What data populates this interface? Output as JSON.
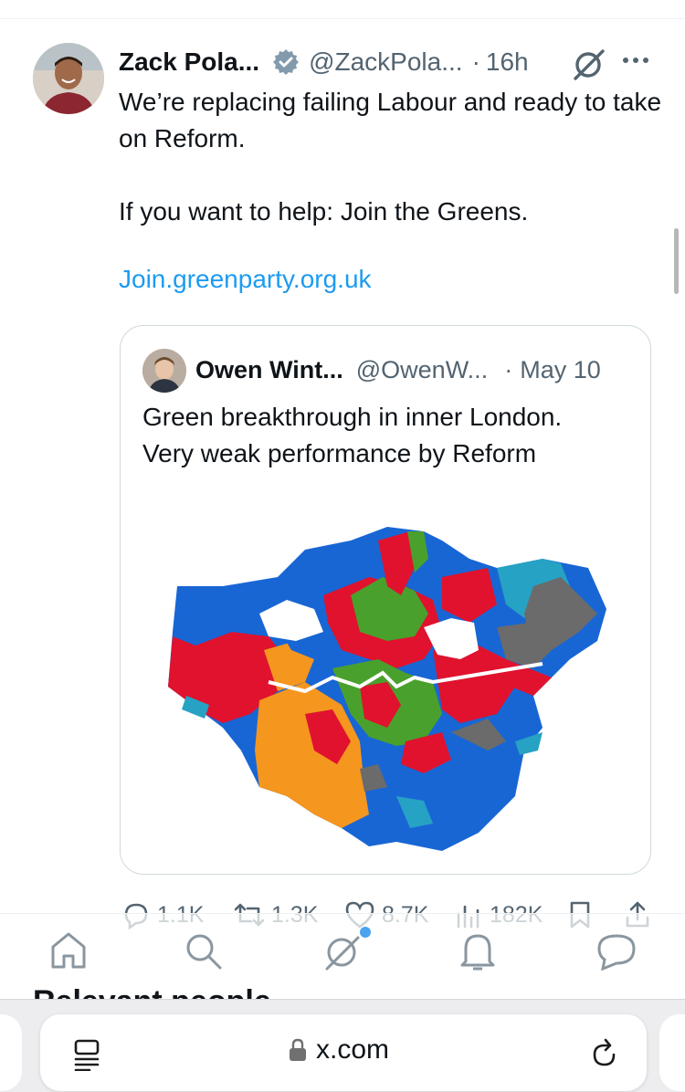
{
  "post": {
    "author_name": "Zack Pola...",
    "author_handle": "@ZackPola...",
    "separator": "·",
    "time": "16h",
    "text_line1": "We’re replacing failing Labour and ready to take on Reform.",
    "text_line2": "If you want to help: Join the Greens.",
    "link": "Join.greenparty.org.uk"
  },
  "quote": {
    "author_name": "Owen Wint...",
    "author_handle": "@OwenW...",
    "separator": "·",
    "date": "May 10",
    "text_line1": "Green breakthrough in inner London.",
    "text_line2": "Very weak performance by Reform"
  },
  "actions": {
    "replies": "1.1K",
    "reposts": "1.3K",
    "likes": "8.7K",
    "views": "182K"
  },
  "section_heading": "Relevant people",
  "browser": {
    "url": "x.com"
  },
  "colors": {
    "link": "#1d9bf0",
    "muted": "#536471",
    "map_labour": "#e0122e",
    "map_green": "#4aa02c",
    "map_conservative": "#1866d4",
    "map_libdem": "#f5961f",
    "map_independent": "#26a2c4",
    "map_reform": "#6b6b6b"
  },
  "icons": [
    "verified-badge-icon",
    "grok-icon",
    "more-icon",
    "reply-icon",
    "repost-icon",
    "like-icon",
    "views-icon",
    "bookmark-icon",
    "share-icon",
    "home-icon",
    "search-icon",
    "grok-tab-icon",
    "notifications-icon",
    "messages-icon",
    "tabs-icon",
    "lock-icon",
    "reload-icon"
  ]
}
